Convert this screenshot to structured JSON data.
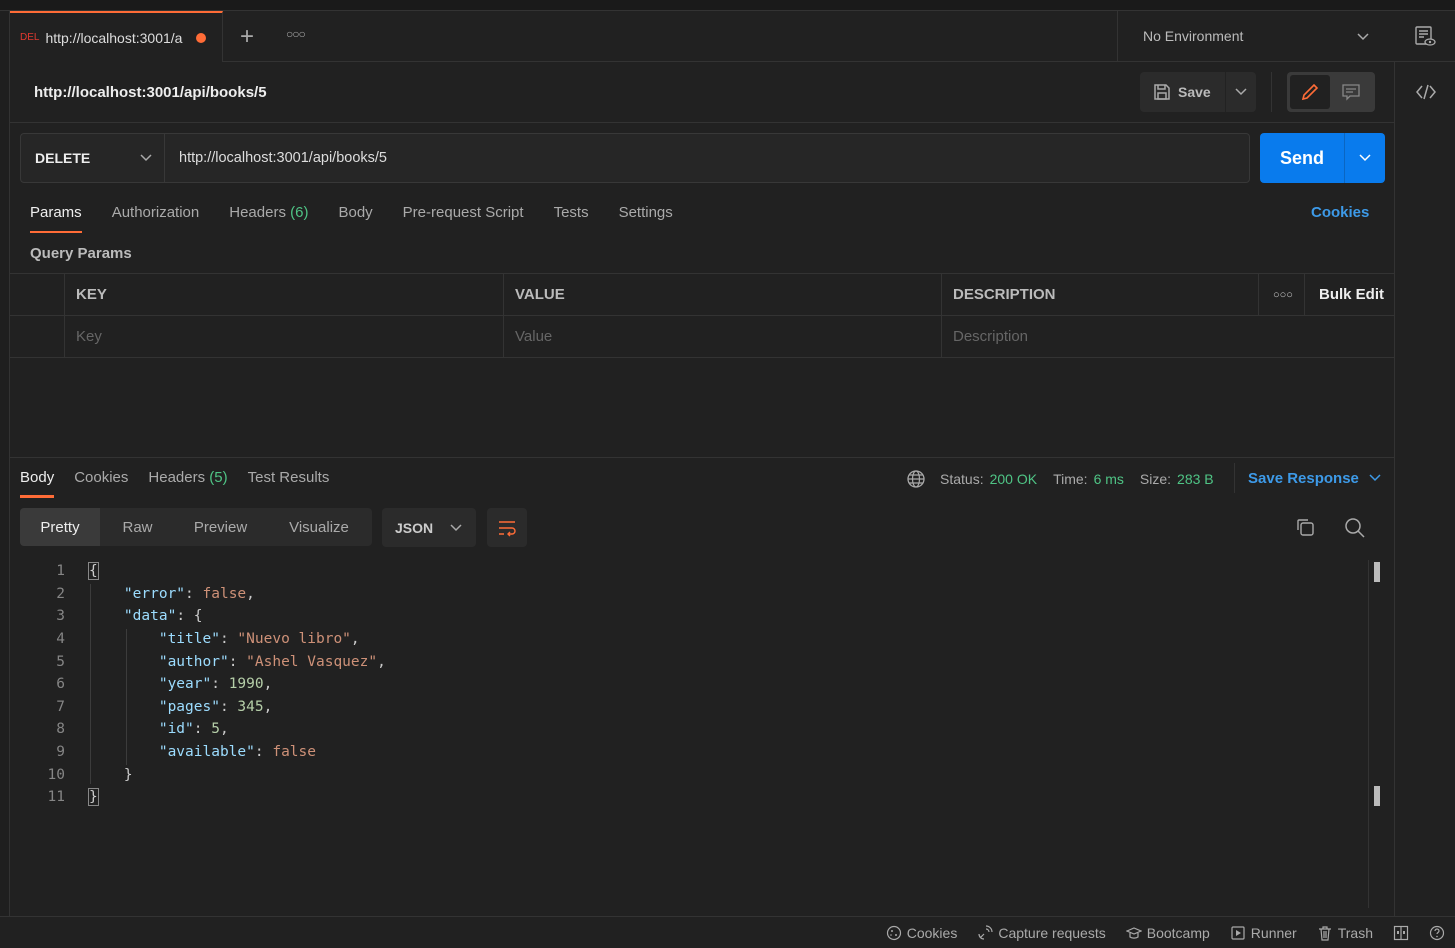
{
  "tab": {
    "method": "DEL",
    "label": "http://localhost:3001/a",
    "unsaved": true
  },
  "environment": {
    "selected": "No Environment"
  },
  "request": {
    "title": "http://localhost:3001/api/books/5",
    "save_label": "Save",
    "method": "DELETE",
    "url": "http://localhost:3001/api/books/5",
    "send_label": "Send",
    "tabs": [
      {
        "label": "Params",
        "active": true
      },
      {
        "label": "Authorization"
      },
      {
        "label": "Headers",
        "count": "(6)"
      },
      {
        "label": "Body"
      },
      {
        "label": "Pre-request Script"
      },
      {
        "label": "Tests"
      },
      {
        "label": "Settings"
      }
    ],
    "cookies_label": "Cookies",
    "query_params_label": "Query Params",
    "table": {
      "headers": [
        "KEY",
        "VALUE",
        "DESCRIPTION"
      ],
      "bulk_edit": "Bulk Edit",
      "placeholders": [
        "Key",
        "Value",
        "Description"
      ]
    }
  },
  "response": {
    "tabs": [
      {
        "label": "Body",
        "active": true
      },
      {
        "label": "Cookies"
      },
      {
        "label": "Headers",
        "count": "(5)"
      },
      {
        "label": "Test Results"
      }
    ],
    "status_label": "Status:",
    "status": "200 OK",
    "time_label": "Time:",
    "time": "6 ms",
    "size_label": "Size:",
    "size": "283 B",
    "save_response": "Save Response",
    "views": [
      "Pretty",
      "Raw",
      "Preview",
      "Visualize"
    ],
    "format": "JSON",
    "code": [
      [
        [
          "{",
          "br"
        ]
      ],
      [
        [
          "    ",
          "p"
        ],
        [
          "\"error\"",
          "k"
        ],
        [
          ": ",
          "p"
        ],
        [
          "false",
          "b"
        ],
        [
          ",",
          "p"
        ]
      ],
      [
        [
          "    ",
          "p"
        ],
        [
          "\"data\"",
          "k"
        ],
        [
          ": {",
          "p"
        ]
      ],
      [
        [
          "        ",
          "p"
        ],
        [
          "\"title\"",
          "k"
        ],
        [
          ": ",
          "p"
        ],
        [
          "\"Nuevo libro\"",
          "s"
        ],
        [
          ",",
          "p"
        ]
      ],
      [
        [
          "        ",
          "p"
        ],
        [
          "\"author\"",
          "k"
        ],
        [
          ": ",
          "p"
        ],
        [
          "\"Ashel Vasquez\"",
          "s"
        ],
        [
          ",",
          "p"
        ]
      ],
      [
        [
          "        ",
          "p"
        ],
        [
          "\"year\"",
          "k"
        ],
        [
          ": ",
          "p"
        ],
        [
          "1990",
          "n"
        ],
        [
          ",",
          "p"
        ]
      ],
      [
        [
          "        ",
          "p"
        ],
        [
          "\"pages\"",
          "k"
        ],
        [
          ": ",
          "p"
        ],
        [
          "345",
          "n"
        ],
        [
          ",",
          "p"
        ]
      ],
      [
        [
          "        ",
          "p"
        ],
        [
          "\"id\"",
          "k"
        ],
        [
          ": ",
          "p"
        ],
        [
          "5",
          "n"
        ],
        [
          ",",
          "p"
        ]
      ],
      [
        [
          "        ",
          "p"
        ],
        [
          "\"available\"",
          "k"
        ],
        [
          ": ",
          "p"
        ],
        [
          "false",
          "b"
        ]
      ],
      [
        [
          "    }",
          "p"
        ]
      ],
      [
        [
          "}",
          "br"
        ]
      ]
    ]
  },
  "statusbar": {
    "items": [
      "Cookies",
      "Capture requests",
      "Bootcamp",
      "Runner",
      "Trash"
    ]
  },
  "colors": {
    "accent": "#ff6c37",
    "send": "#097bed",
    "link": "#3d9ae8",
    "success": "#4fc485"
  }
}
